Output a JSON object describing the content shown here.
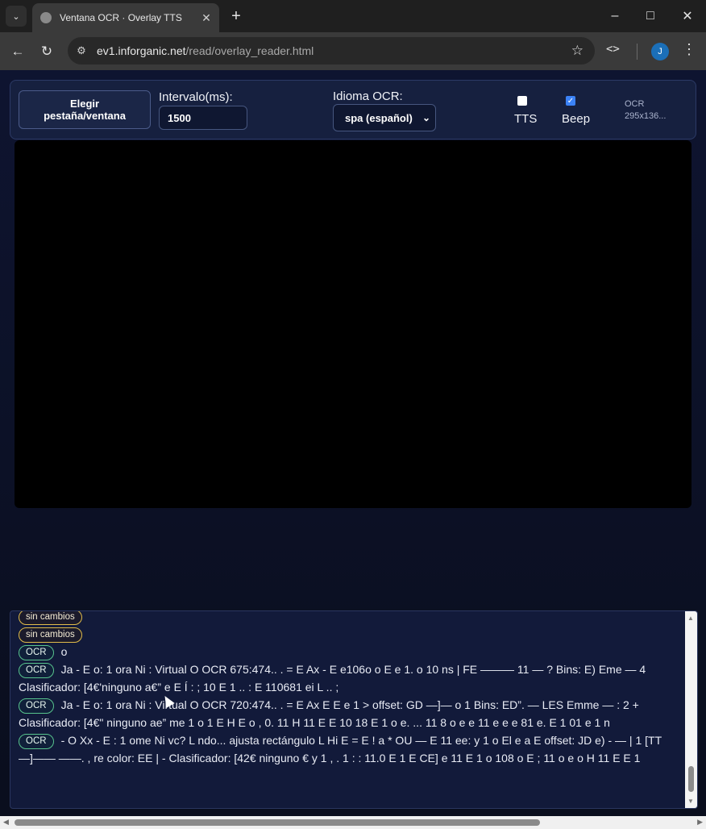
{
  "browser": {
    "tab_title": "Ventana OCR · Overlay TTS",
    "url_host": "ev1.inforganic.net",
    "url_path": "/read/overlay_reader.html",
    "avatar_letter": "J"
  },
  "controls": {
    "pick_button": "Elegir pestaña/ventana",
    "interval_label": "Intervalo(ms):",
    "interval_value": "1500",
    "language_label": "Idioma OCR:",
    "language_value": "spa (español)",
    "tts_label": "TTS",
    "tts_checked": false,
    "beep_label": "Beep",
    "beep_checked": true,
    "ocr_label": "OCR",
    "ocr_size": "295x136..."
  },
  "log": {
    "entries": [
      {
        "badge": "sin cambios",
        "kind": "nc",
        "text": ""
      },
      {
        "badge": "sin cambios",
        "kind": "nc",
        "text": ""
      },
      {
        "badge": "OCR",
        "kind": "ocr",
        "text": "o"
      },
      {
        "badge": "OCR",
        "kind": "ocr",
        "text": "Ja - E o: 1 ora Ni : Virtual O OCR 675:474.. . = E Ax - E e106o o E e 1. o 10 ns | FE ——— 11 — ? Bins: E) Eme — 4 Clasificador: [4€'ninguno a€” e E Í : ; 10 E 1 .. : E 110681 ei L .. ;"
      },
      {
        "badge": "OCR",
        "kind": "ocr",
        "text": "Ja - E o: 1 ora Ni : Virtual O OCR 720:474.. . = E Ax E E e 1 > offset: GD —]— o 1 Bins: ED”. — LES Emme — : 2 + Clasificador: [4€\" ninguno ae” me 1 o 1 E H E o , 0. 11 H 11 E E 10 18 E 1 o e. ... 11 8 o e e 11 e e e 81 e. E 1 01 e 1 n"
      },
      {
        "badge": "OCR",
        "kind": "ocr",
        "text": "- O Xx - E : 1 ome Ni vc? L ndo... ajusta rectángulo L Hi E = E ! a * OU — E 11 ee: y 1 o El e a E offset: JD e) - — | 1 [TT —]—— ——. , re color: EE | - Clasificador: [42€ ninguno € y 1 , . 1 : : 11.0 E 1 E CE] e 11 E 1 o 108 o E ; 11 o e o H 11 E E 1"
      }
    ]
  }
}
